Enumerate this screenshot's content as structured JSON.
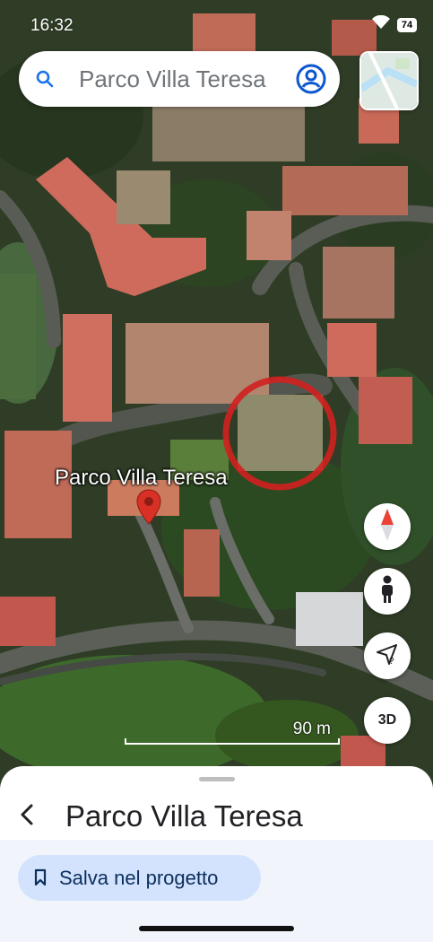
{
  "status_bar": {
    "time": "16:32",
    "battery": "74",
    "icons": [
      "wifi-icon",
      "battery-icon"
    ]
  },
  "search": {
    "query": "Parco Villa Teresa",
    "icons": [
      "search-icon",
      "account-icon"
    ]
  },
  "map": {
    "view": "satellite",
    "place_label": "Parco Villa Teresa",
    "pin_color": "#d93025",
    "highlight_circle_color": "#d1201f",
    "scale_label": "90 m"
  },
  "controls": {
    "compass": "compass-icon",
    "street_view": "pegman-icon",
    "location": "location-unknown-icon",
    "three_d_label": "3D"
  },
  "sheet": {
    "title": "Parco Villa Teresa",
    "save_button_label": "Salva nel progetto",
    "chip_color": "#d3e3fd"
  }
}
